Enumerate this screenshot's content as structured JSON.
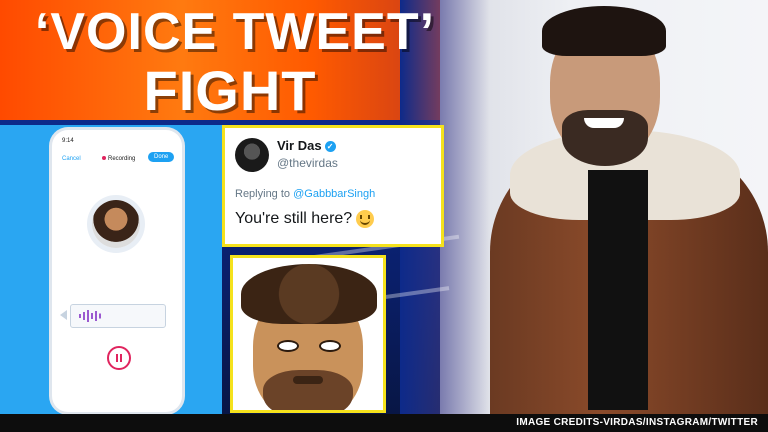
{
  "headline": {
    "line1": "‘VOICE TWEET’",
    "line2": "FIGHT"
  },
  "phone": {
    "time": "9:14",
    "cancel_label": "Cancel",
    "status": "Recording",
    "done_label": "Done"
  },
  "tweet": {
    "name": "Vir Das",
    "handle": "@thevirdas",
    "replying_prefix": "Replying to",
    "replying_to": "@GabbbarSingh",
    "text": "You're still here?"
  },
  "credits": "IMAGE CREDITS-VIRDAS/INSTAGRAM/TWITTER",
  "colors": {
    "accent_orange": "#ff5a00",
    "twitter_blue": "#1da1f2",
    "panel_border": "#f5e21c"
  }
}
